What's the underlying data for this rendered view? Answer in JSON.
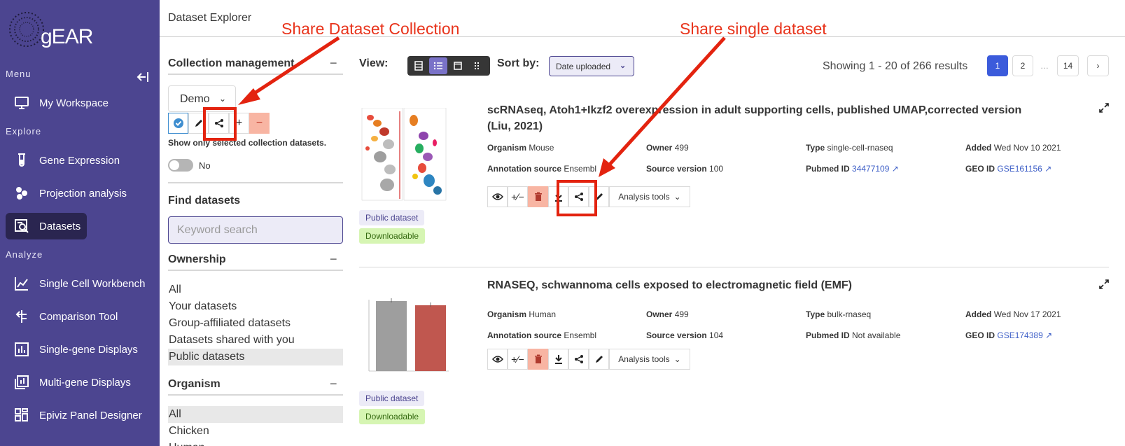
{
  "app": {
    "logo_text": "gEAR",
    "page_title": "Dataset Explorer"
  },
  "sidebar": {
    "sections": {
      "menu": "Menu",
      "explore": "Explore",
      "analyze": "Analyze"
    },
    "items": [
      {
        "label": "My Workspace",
        "icon": "monitor-icon"
      },
      {
        "label": "Gene Expression",
        "icon": "test-tube-icon"
      },
      {
        "label": "Projection analysis",
        "icon": "circles-icon"
      },
      {
        "label": "Datasets",
        "icon": "dataset-search-icon",
        "active": true
      },
      {
        "label": "Single Cell Workbench",
        "icon": "line-chart-icon"
      },
      {
        "label": "Comparison Tool",
        "icon": "compare-arrows-icon"
      },
      {
        "label": "Single-gene Displays",
        "icon": "bar-chart-icon"
      },
      {
        "label": "Multi-gene Displays",
        "icon": "multi-bar-chart-icon"
      },
      {
        "label": "Epiviz Panel Designer",
        "icon": "grid-layout-icon"
      }
    ]
  },
  "collection": {
    "title": "Collection management",
    "selected": "Demo",
    "show_only_label": "Show only selected collection datasets.",
    "toggle_value": "No"
  },
  "find": {
    "title": "Find datasets",
    "placeholder": "Keyword search"
  },
  "ownership": {
    "title": "Ownership",
    "options": [
      "All",
      "Your datasets",
      "Group-affiliated datasets",
      "Datasets shared with you",
      "Public datasets"
    ],
    "selected": "Public datasets"
  },
  "organism": {
    "title": "Organism",
    "options": [
      "All",
      "Chicken",
      "Human"
    ],
    "selected": "All"
  },
  "toolbar": {
    "view_label": "View:",
    "sort_label": "Sort by:",
    "sort_value": "Date uploaded",
    "showing": "Showing 1 - 20 of 266 results"
  },
  "pagination": {
    "pages": [
      "1",
      "2",
      "…",
      "14",
      "›"
    ],
    "current": "1"
  },
  "results": [
    {
      "title": "scRNAseq, Atoh1+Ikzf2 overexpression in adult supporting cells, published UMAP,corrected version (Liu, 2021)",
      "organism_label": "Organism",
      "organism": "Mouse",
      "owner_label": "Owner",
      "owner": "499",
      "type_label": "Type",
      "type": "single-cell-rnaseq",
      "added_label": "Added",
      "added": "Wed Nov 10 2021",
      "annotation_label": "Annotation source",
      "annotation": "Ensembl",
      "source_version_label": "Source version",
      "source_version": "100",
      "pubmed_label": "Pubmed ID",
      "pubmed": "34477109",
      "geo_label": "GEO ID",
      "geo": "GSE161156",
      "analysis_tools": "Analysis tools",
      "tags": [
        "Public dataset",
        "Downloadable"
      ]
    },
    {
      "title": "RNASEQ, schwannoma cells exposed to electromagnetic field (EMF)",
      "organism_label": "Organism",
      "organism": "Human",
      "owner_label": "Owner",
      "owner": "499",
      "type_label": "Type",
      "type": "bulk-rnaseq",
      "added_label": "Added",
      "added": "Wed Nov 17 2021",
      "annotation_label": "Annotation source",
      "annotation": "Ensembl",
      "source_version_label": "Source version",
      "source_version": "104",
      "pubmed_label": "Pubmed ID",
      "pubmed": "Not available",
      "geo_label": "GEO ID",
      "geo": "GSE174389",
      "analysis_tools": "Analysis tools",
      "tags": [
        "Public dataset",
        "Downloadable"
      ]
    }
  ],
  "annotations": {
    "share_collection": "Share Dataset Collection",
    "share_single": "Share single dataset"
  },
  "colors": {
    "sidebar": "#4c4590",
    "sidebar_active": "#2a2550",
    "accent": "#3b5bdb",
    "annotation_red": "#e3230f",
    "delete_bg": "#f8b5a3",
    "tag_public_bg": "#ecebf7",
    "tag_download_bg": "#d6f5b3"
  }
}
